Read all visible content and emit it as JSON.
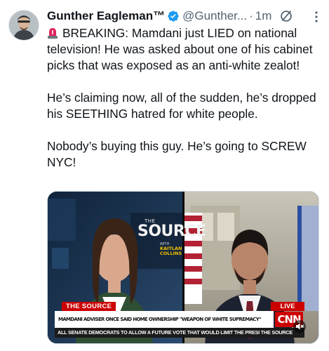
{
  "tweet": {
    "display_name": "Gunther Eagleman™",
    "handle": "@Gunther...",
    "separator": "·",
    "time": "1m",
    "paragraphs": [
      "BREAKING: Mamdani just LIED on national television! He was asked about one of his cabinet picks that was exposed as an anti-white zealot!",
      "He’s claiming now, all of the sudden, he’s dropped his SEETHING hatred for white people.",
      "Nobody’s buying this guy. He’s going to SCREW NYC!"
    ],
    "icons": {
      "avatar": "avatar",
      "verified": "verified-badge-icon",
      "grok": "grok-icon",
      "more": "more-icon",
      "siren": "siren-emoji-icon",
      "mute": "mute-icon"
    }
  },
  "media": {
    "show_logo_the": "THE",
    "show_logo_word": "SOURCE",
    "show_logo_with": "WITH",
    "show_logo_host": "KAITLAN COLLINS",
    "show_name": "THE SOURCE",
    "live_label": "LIVE",
    "headline": "MAMDANI ADVISER ONCE SAID HOME OWNERSHIP \"WEAPON OF WHITE SUPREMACY\"",
    "network": "CNN",
    "ticker": "ALL SENATE DEMOCRATS TO ALLOW A FUTURE VOTE THAT WOULD LIMIT THE PRESI THE SOURCE"
  },
  "colors": {
    "text_primary": "#0f1419",
    "text_secondary": "#536471",
    "verified_blue": "#1d9bf0",
    "cnn_red": "#cc0000"
  }
}
